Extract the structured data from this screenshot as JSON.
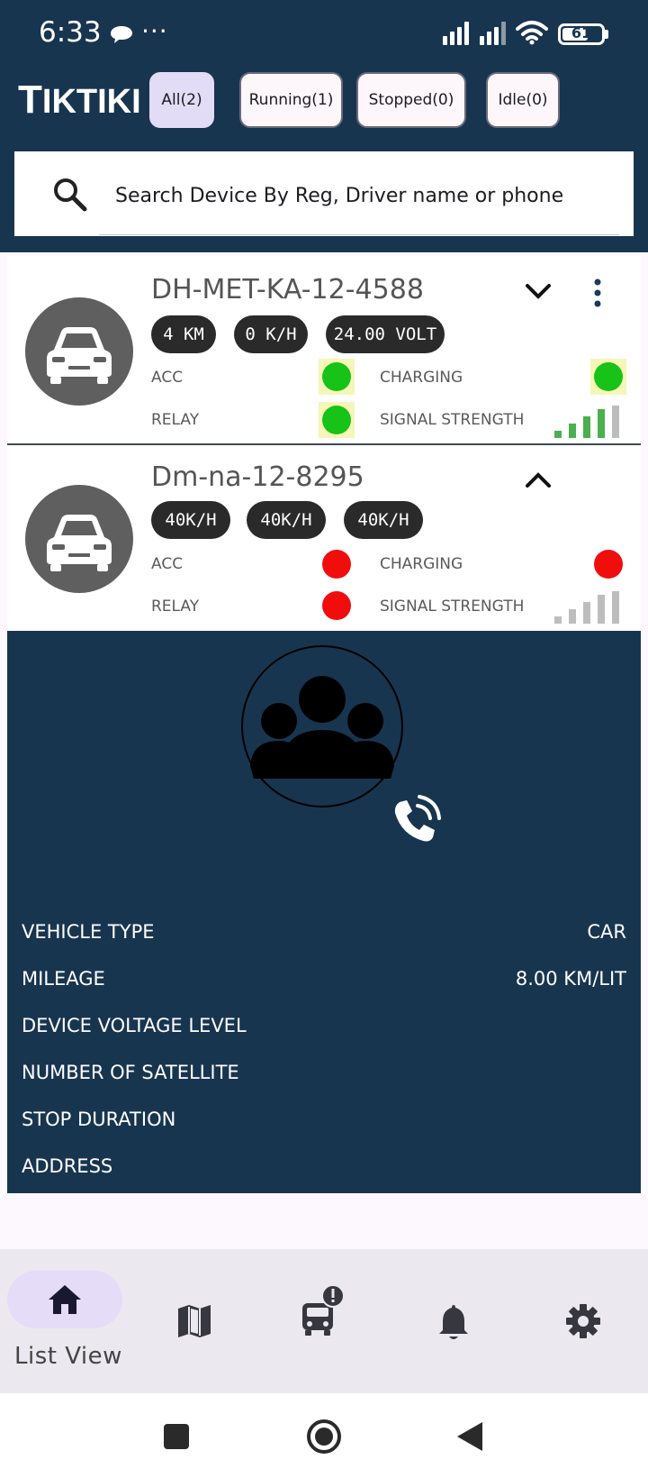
{
  "status_bar": {
    "time": "6:33",
    "battery": "61",
    "dots": "···"
  },
  "app": {
    "brand": "TIKTIKI"
  },
  "filters": [
    {
      "label": "All(2)",
      "active": true
    },
    {
      "label": "Running(1)",
      "active": false
    },
    {
      "label": "Stopped(0)",
      "active": false
    },
    {
      "label": "Idle(0)",
      "active": false
    }
  ],
  "search": {
    "placeholder": "Search Device By Reg, Driver name or phone"
  },
  "devices": [
    {
      "reg": "DH-MET-KA-12-4588",
      "pills": [
        "4 KM",
        "0 K/H",
        "24.00 VOLT"
      ],
      "acc_label": "ACC",
      "relay_label": "RELAY",
      "charging_label": "CHARGING",
      "signal_label": "SIGNAL STRENGTH",
      "acc_status": "on",
      "relay_status": "on",
      "charging_status": "on",
      "signal_bars_active": 4,
      "expanded": false
    },
    {
      "reg": "Dm-na-12-8295",
      "pills": [
        "40K/H",
        "40K/H",
        "40K/H"
      ],
      "acc_label": "ACC",
      "relay_label": "RELAY",
      "charging_label": "CHARGING",
      "signal_label": "SIGNAL STRENGTH",
      "acc_status": "off",
      "relay_status": "off",
      "charging_status": "off",
      "signal_bars_active": 0,
      "expanded": true
    }
  ],
  "details": {
    "rows": [
      {
        "label": "VEHICLE TYPE",
        "value": "CAR"
      },
      {
        "label": "MILEAGE",
        "value": "8.00 KM/LIT"
      },
      {
        "label": "DEVICE VOLTAGE LEVEL",
        "value": ""
      },
      {
        "label": "NUMBER OF SATELLITE",
        "value": ""
      },
      {
        "label": "STOP DURATION",
        "value": ""
      },
      {
        "label": "ADDRESS",
        "value": ""
      }
    ]
  },
  "bottom_nav": {
    "active_label": "List View",
    "items": [
      "home-icon",
      "map-icon",
      "bus-alert-icon",
      "bell-icon",
      "gear-icon"
    ]
  },
  "colors": {
    "header": "#183550",
    "status_on": "#16c316",
    "status_off": "#f20d0d",
    "signal_on": "#4caf50",
    "signal_off": "#bdbdbd"
  }
}
